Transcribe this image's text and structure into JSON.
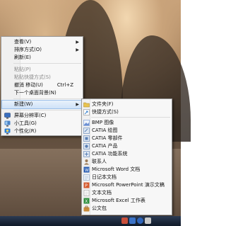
{
  "context_menu": {
    "items": [
      {
        "label": "查看(V)",
        "arrow": "▶"
      },
      {
        "label": "排序方式(O)",
        "arrow": "▶"
      },
      {
        "label": "刷新(E)"
      },
      {
        "label": "粘贴(P)",
        "disabled": true
      },
      {
        "label": "粘贴快捷方式(S)",
        "disabled": true
      },
      {
        "label": "撤消 移动(U)",
        "shortcut": "Ctrl+Z"
      },
      {
        "label": "下一个桌面背景(N)"
      },
      {
        "label": "新建(W)",
        "arrow": "▶"
      },
      {
        "label": "屏幕分辨率(C)"
      },
      {
        "label": "小工具(G)"
      },
      {
        "label": "个性化(R)"
      }
    ]
  },
  "new_submenu": {
    "items": [
      {
        "label": "文件夹(F)",
        "icon": "folder-icon",
        "color": "#e8c34f"
      },
      {
        "label": "快捷方式(S)",
        "icon": "shortcut-icon",
        "color": "#3f86cf"
      },
      {
        "label": "BMP 图像",
        "icon": "bmp-icon",
        "color": "#6b8fd3"
      },
      {
        "label": "CATIA 绘图",
        "icon": "catia-drawing-icon",
        "color": "#5a7fb5"
      },
      {
        "label": "CATIA 零部件",
        "icon": "catia-part-icon",
        "color": "#5a7fb5"
      },
      {
        "label": "CATIA 产品",
        "icon": "catia-product-icon",
        "color": "#5a7fb5"
      },
      {
        "label": "CATIA 功能系统",
        "icon": "catia-system-icon",
        "color": "#5a7fb5"
      },
      {
        "label": "联系人",
        "icon": "contact-icon",
        "color": "#9d7b58"
      },
      {
        "label": "Microsoft Word 文档",
        "icon": "word-icon",
        "color": "#2b5fb3"
      },
      {
        "label": "日记本文档",
        "icon": "journal-icon",
        "color": "#8aa7c7"
      },
      {
        "label": "Microsoft PowerPoint 演示文稿",
        "icon": "powerpoint-icon",
        "color": "#d55a2e"
      },
      {
        "label": "文本文档",
        "icon": "text-document-icon",
        "color": "#cfcfcf"
      },
      {
        "label": "Microsoft Excel 工作表",
        "icon": "excel-icon",
        "color": "#2f8f3f"
      },
      {
        "label": "公文包",
        "icon": "briefcase-icon",
        "color": "#c78a3a"
      }
    ]
  },
  "context_icons": {
    "screen_resolution": "#3a6fbf",
    "gadgets": "#4a82c6",
    "personalize": "#2f7fd6"
  },
  "taskbar": {
    "tray_icons": [
      {
        "name": "volume-icon",
        "color": "#c94f3a"
      },
      {
        "name": "network-icon",
        "color": "#3b73c7"
      },
      {
        "name": "help-icon",
        "color": "#2f65bb"
      },
      {
        "name": "flag-icon",
        "color": "#c9c9c9"
      }
    ]
  }
}
